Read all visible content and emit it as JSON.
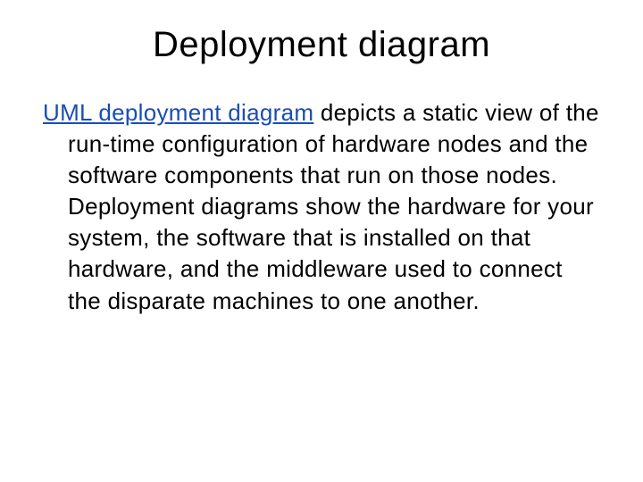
{
  "title": "Deployment diagram",
  "link_text": "UML deployment diagram",
  "body_text": " depicts a static view of the run-time configuration of hardware nodes and the software components that run on those nodes. Deployment diagrams show the hardware for your system, the software that is installed on that hardware, and the middleware used to connect the disparate machines to one another."
}
